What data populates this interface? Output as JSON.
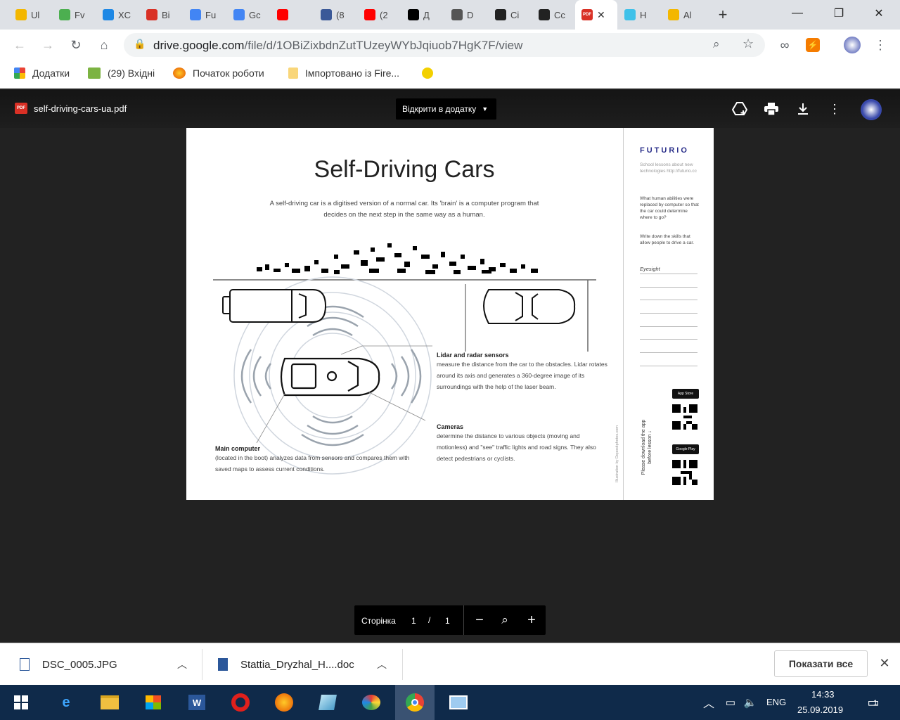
{
  "tabs": [
    {
      "title": "Ul",
      "color": "#f3b700"
    },
    {
      "title": "Fv",
      "color": "#4caf50"
    },
    {
      "title": "XC",
      "color": "#1e88e5"
    },
    {
      "title": "Bi",
      "color": "#d93025"
    },
    {
      "title": "Fu",
      "color": "#4285f4"
    },
    {
      "title": "Gc",
      "color": "#4285f4"
    },
    {
      "title": "",
      "color": "#ff0000"
    },
    {
      "title": "(8",
      "color": "#3b5998"
    },
    {
      "title": "(2",
      "color": "#ff0000"
    },
    {
      "title": "Д",
      "color": "#000000"
    },
    {
      "title": "D",
      "color": "#555555"
    },
    {
      "title": "Ci",
      "color": "#222222"
    },
    {
      "title": "Cc",
      "color": "#222222"
    },
    {
      "title": "",
      "color": "#d93025"
    },
    {
      "title": "H",
      "color": "#3fc1e9"
    },
    {
      "title": "Al",
      "color": "#f3b700"
    }
  ],
  "window": {
    "minimize": "—",
    "maximize": "❐",
    "close": "✕"
  },
  "address": {
    "url_host": "drive.google.com",
    "url_path": "/file/d/1OBiZixbdnZutTUzeyWYbJqiuob7HgK7F/view"
  },
  "bookmarks": {
    "apps": "Додатки",
    "inbox": "(29) Вхідні",
    "getting_started": "Початок роботи",
    "imported": "Імпортовано із Fire..."
  },
  "viewer": {
    "pdf_badge": "PDF",
    "file_name": "self-driving-cars-ua.pdf",
    "open_with": "Відкрити в додатку"
  },
  "doc": {
    "title": "Self-Driving Cars",
    "intro": "A self-driving car is a digitised version of a normal car. Its 'brain' is a computer program that decides on the next step in the same way as a human.",
    "lidar_heading": "Lidar and radar sensors",
    "lidar_text": "measure the distance from the car to the obstacles. Lidar rotates around its axis and generates a 360-degree image of its surroundings with the help of the laser beam.",
    "cameras_heading": "Cameras",
    "cameras_text": "determine the distance to various objects (moving and motionless) and \"see\" traffic lights and road signs. They also detect pedestrians or cyclists.",
    "computer_heading": "Main computer",
    "computer_text": "(located in the boot) analyzes data from sensors and compares them with saved maps to assess current conditions.",
    "credit": "Illustration by Depositphotos.com",
    "brand": "FUTURIO",
    "brand_sub": "School lessons about new technologies http://futurio.cc",
    "question": "What human abilities were replaced by computer so that the car could determine where to go?",
    "task": "Write down the skills that allow people to drive a car.",
    "answer": "Eyesight",
    "download": "Please download the app before lesson ↓",
    "app_store": "App Store",
    "google_play": "Google Play"
  },
  "page_ctrl": {
    "label": "Сторінка",
    "current": "1",
    "sep": "/",
    "total": "1"
  },
  "downloads": [
    {
      "name": "DSC_0005.JPG"
    },
    {
      "name": "Stattia_Dryzhal_H....doc"
    }
  ],
  "shelf": {
    "show_all": "Показати все"
  },
  "taskbar": {
    "lang": "ENG",
    "time": "14:33",
    "date": "25.09.2019",
    "notif": "1"
  }
}
